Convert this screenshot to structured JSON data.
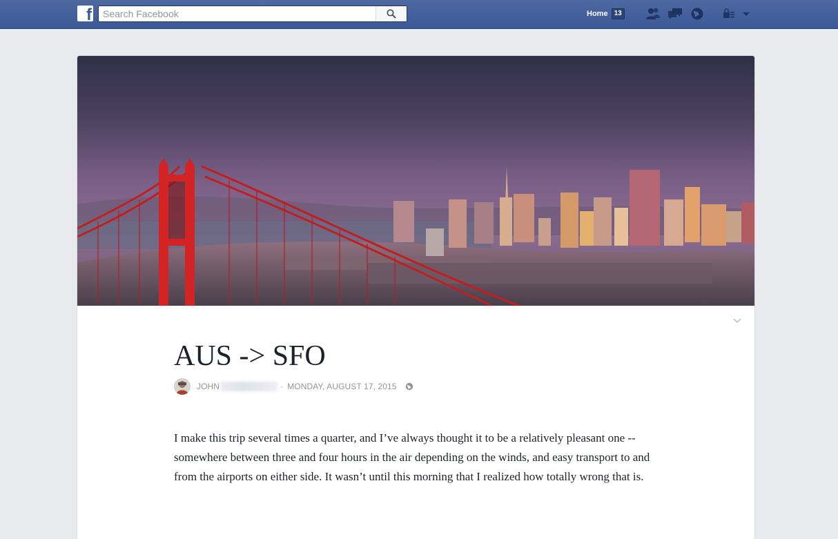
{
  "topbar": {
    "search_placeholder": "Search Facebook",
    "home_label": "Home",
    "home_count": "13",
    "icons": [
      "facebook-logo",
      "search-icon",
      "friend-requests-icon",
      "messages-icon",
      "notifications-globe-icon",
      "privacy-shortcuts-icon",
      "account-menu-chevron-icon"
    ],
    "brand_color": "#3b5998"
  },
  "note": {
    "cover_description_icon": "cover-photo",
    "title": "AUS -> SFO",
    "author": "John",
    "separator": "·",
    "date": "Monday, August 17, 2015",
    "audience_icon": "public-globe-icon",
    "body": "I make this trip several times a quarter, and I’ve always thought it to be a relatively pleasant one -- somewhere between three and four hours in the air depending on the winds, and easy transport to and from the airports on either side. It wasn’t until this morning that I realized how totally wrong that is."
  }
}
